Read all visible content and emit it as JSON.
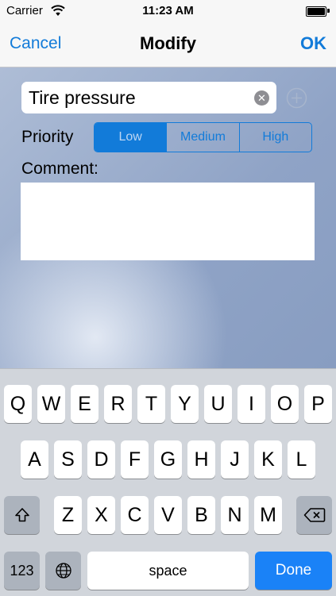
{
  "status_bar": {
    "carrier": "Carrier",
    "time": "11:23 AM"
  },
  "nav": {
    "cancel": "Cancel",
    "title": "Modify",
    "ok": "OK"
  },
  "form": {
    "title_value": "Tire pressure",
    "priority_label": "Priority",
    "priority_options": [
      "Low",
      "Medium",
      "High"
    ],
    "priority_selected": "Low",
    "comment_label": "Comment:",
    "comment_value": ""
  },
  "keyboard": {
    "row1": [
      "Q",
      "W",
      "E",
      "R",
      "T",
      "Y",
      "U",
      "I",
      "O",
      "P"
    ],
    "row2": [
      "A",
      "S",
      "D",
      "F",
      "G",
      "H",
      "J",
      "K",
      "L"
    ],
    "row3": [
      "Z",
      "X",
      "C",
      "V",
      "B",
      "N",
      "M"
    ],
    "numbers_label": "123",
    "space_label": "space",
    "done_label": "Done"
  },
  "colors": {
    "accent": "#127bd9",
    "done_key": "#1a82f7"
  }
}
